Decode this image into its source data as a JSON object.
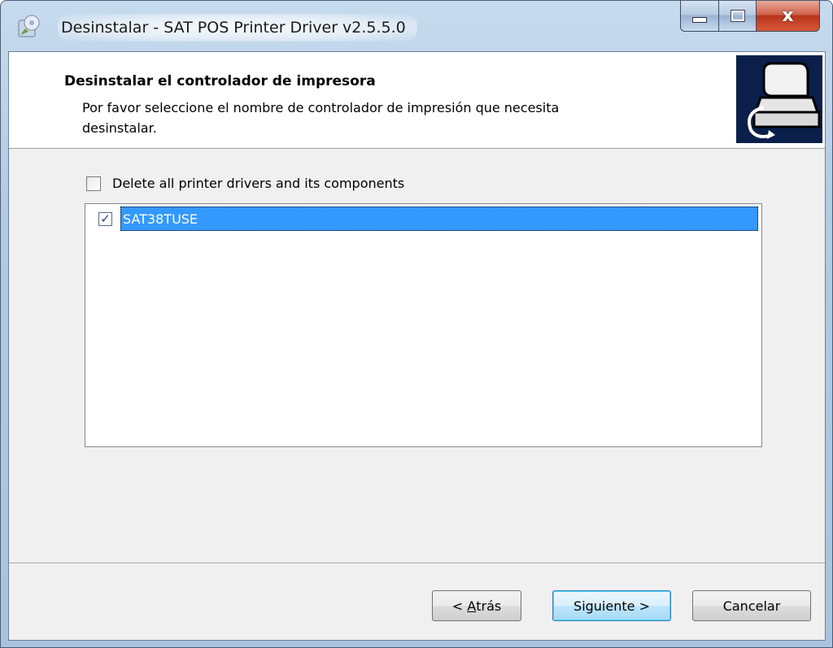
{
  "window": {
    "title": "Desinstalar - SAT POS Printer Driver v2.5.5.0",
    "close_glyph": "x",
    "icons": {
      "app": "installer-disc-icon",
      "minimize": "minimize-icon",
      "maximize": "maximize-icon",
      "close": "close-icon"
    }
  },
  "header": {
    "title": "Desinstalar el controlador de impresora",
    "description_line1": "Por favor seleccione el nombre de controlador de impresión que necesita",
    "description_line2": "desinstalar.",
    "image_icon": "printer-uninstall-icon"
  },
  "options": {
    "delete_all_label": "Delete all printer drivers and its components",
    "delete_all_checked": false
  },
  "drivers": [
    {
      "name": "SAT38TUSE",
      "checked": true,
      "selected": true,
      "check_glyph": "✓"
    }
  ],
  "buttons": {
    "back_prefix": "< ",
    "back_mnemonic": "A",
    "back_rest": "trás",
    "next": "Siguiente >",
    "cancel": "Cancelar"
  },
  "colors": {
    "selection": "#3399ff",
    "header_bg": "#ffffff",
    "client_bg": "#f0f0f0",
    "close_button": "#c9452c"
  }
}
